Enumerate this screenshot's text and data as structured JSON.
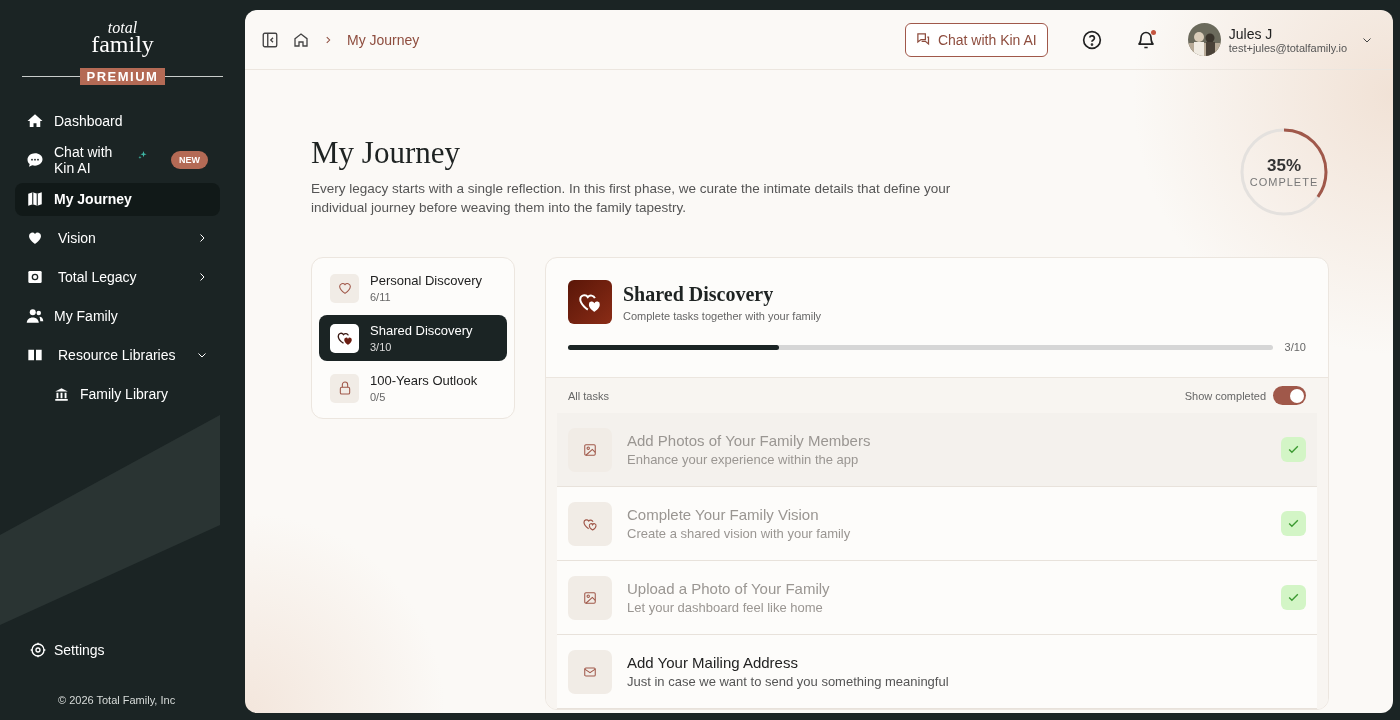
{
  "sidebar": {
    "logo": {
      "line1": "total",
      "line2": "family"
    },
    "plan_badge": "PREMIUM",
    "items": [
      {
        "label": "Dashboard",
        "selected": false
      },
      {
        "label": "Chat with Kin AI",
        "selected": false,
        "badge": "NEW"
      },
      {
        "label": "My Journey",
        "selected": true
      },
      {
        "label": "Vision",
        "selected": false,
        "expanded": false
      },
      {
        "label": "Total Legacy",
        "selected": false,
        "expanded": false
      },
      {
        "label": "My Family",
        "selected": false
      },
      {
        "label": "Resource Libraries",
        "selected": false,
        "expanded": true,
        "children": [
          {
            "label": "Family Library",
            "selected": false
          }
        ]
      }
    ],
    "settings": "Settings",
    "copyright": "© 2026 Total Family, Inc"
  },
  "header": {
    "breadcrumb": "My Journey",
    "chat_button": "Chat with Kin AI",
    "notifications_unread": true,
    "user": {
      "name": "Jules J",
      "email": "test+jules@totalfamily.io"
    }
  },
  "journey": {
    "title": "My Journey",
    "description": "Every legacy starts with a single reflection. In this first phase, we curate the intimate details that define your individual journey before weaving them into the family tapestry.",
    "progress": {
      "value": "35%",
      "label": "COMPLETE",
      "level": 0.35
    }
  },
  "phases": [
    {
      "title": "Personal Discovery",
      "count": "6/11",
      "selected": false
    },
    {
      "title": "Shared Discovery",
      "count": "3/10",
      "selected": true
    },
    {
      "title": "100-Years Outlook",
      "count": "0/5",
      "selected": false
    }
  ],
  "detail": {
    "title": "Shared Discovery",
    "subtitle": "Complete tasks together with your family",
    "level": 0.3,
    "count": "3/10",
    "list_label": "All tasks",
    "toggle": {
      "label": "Show completed",
      "on": true
    },
    "tasks": [
      {
        "title": "Add Photos of Your Family Members",
        "subtitle": "Enhance your experience within the app",
        "completed": true,
        "selected": true
      },
      {
        "title": "Complete Your Family Vision",
        "subtitle": "Create a shared vision with your family",
        "completed": true,
        "selected": false
      },
      {
        "title": "Upload a Photo of Your Family",
        "subtitle": "Let your dashboard feel like home",
        "completed": true,
        "selected": false
      },
      {
        "title": "Add Your Mailing Address",
        "subtitle": "Just in case we want to send you something meaningful",
        "completed": false,
        "selected": false
      }
    ]
  }
}
